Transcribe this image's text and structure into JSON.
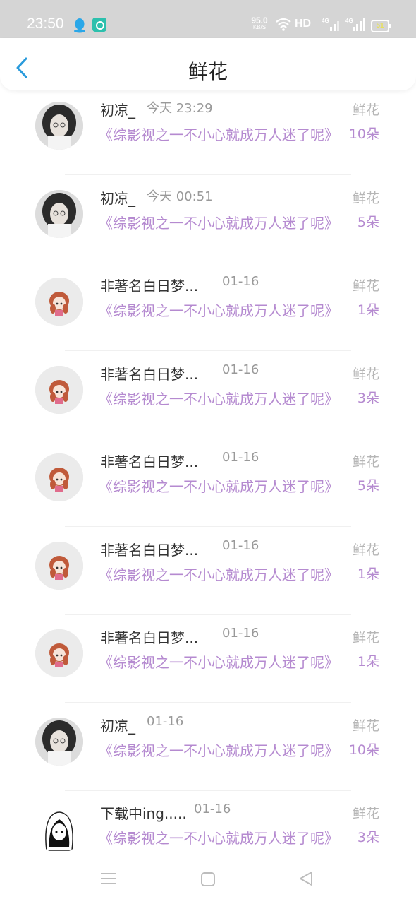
{
  "status": {
    "time": "23:50",
    "speed_value": "95.0",
    "speed_unit": "KB/S",
    "hd": "HD",
    "net1": "4G",
    "net2": "4G",
    "battery": "51"
  },
  "header": {
    "title": "鲜花"
  },
  "records": [
    {
      "name": "初凉_",
      "date": "今天 23:29",
      "book": "《综影视之一不小心就成万人迷了呢》",
      "label": "鲜花",
      "count": "10朵",
      "avatar": "dark"
    },
    {
      "name": "初凉_",
      "date": "今天 00:51",
      "book": "《综影视之一不小心就成万人迷了呢》",
      "label": "鲜花",
      "count": "5朵",
      "avatar": "dark"
    },
    {
      "name": "非著名白日梦...",
      "date": "01-16",
      "book": "《综影视之一不小心就成万人迷了呢》",
      "label": "鲜花",
      "count": "1朵",
      "avatar": "girl"
    },
    {
      "name": "非著名白日梦...",
      "date": "01-16",
      "book": "《综影视之一不小心就成万人迷了呢》",
      "label": "鲜花",
      "count": "3朵",
      "avatar": "girl"
    },
    {
      "name": "非著名白日梦...",
      "date": "01-16",
      "book": "《综影视之一不小心就成万人迷了呢》",
      "label": "鲜花",
      "count": "5朵",
      "avatar": "girl"
    },
    {
      "name": "非著名白日梦...",
      "date": "01-16",
      "book": "《综影视之一不小心就成万人迷了呢》",
      "label": "鲜花",
      "count": "1朵",
      "avatar": "girl"
    },
    {
      "name": "非著名白日梦...",
      "date": "01-16",
      "book": "《综影视之一不小心就成万人迷了呢》",
      "label": "鲜花",
      "count": "1朵",
      "avatar": "girl"
    },
    {
      "name": "初凉_",
      "date": "01-16",
      "book": "《综影视之一不小心就成万人迷了呢》",
      "label": "鲜花",
      "count": "10朵",
      "avatar": "dark"
    },
    {
      "name": "下载中ing.....",
      "date": "01-16",
      "book": "《综影视之一不小心就成万人迷了呢》",
      "label": "鲜花",
      "count": "3朵",
      "avatar": "sketch"
    }
  ],
  "colors": {
    "accent": "#b58ad0",
    "back": "#2a9bdc",
    "statusbar": "#d5d5d5"
  },
  "icons": {
    "back": "chevron-left-icon",
    "menu": "menu-icon",
    "home": "square-home-icon",
    "nav_back": "triangle-back-icon"
  }
}
